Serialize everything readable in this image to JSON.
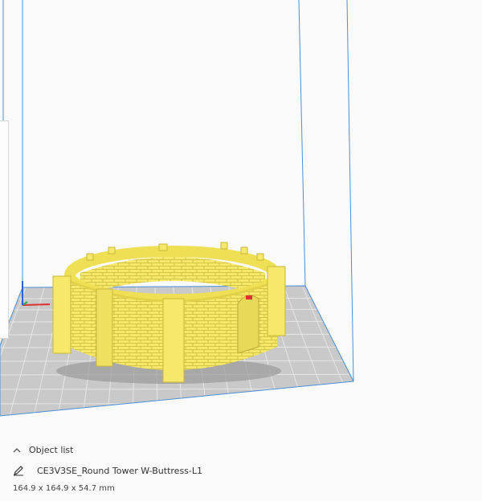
{
  "object_list": {
    "header_label": "Object list",
    "selected_object": "CE3V3SE_Round Tower W-Buttress-L1",
    "dimensions": "164.9 x 164.9 x 54.7 mm"
  },
  "icons": {
    "collapse": "chevron-up-icon",
    "edit": "pencil-icon"
  },
  "colors": {
    "model": "#f6e86a",
    "model_shadow": "#d9c93e",
    "build_plate": "#c9c9c9",
    "grid_lines": "#e8e8e8",
    "volume_edges": "#4a8fd6",
    "x_axis": "#e03030",
    "y_axis": "#2aa84a",
    "z_axis": "#3060e0"
  }
}
